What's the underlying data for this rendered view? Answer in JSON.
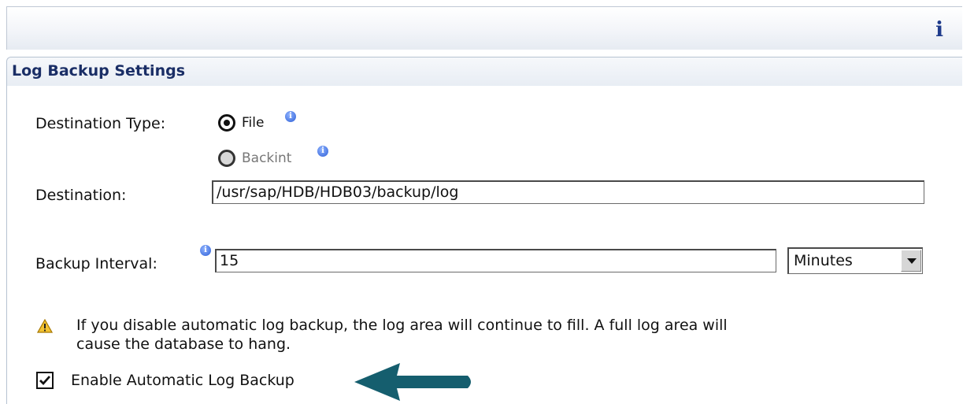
{
  "topbar": {
    "info_icon": "i"
  },
  "panel": {
    "title": "Log Backup Settings"
  },
  "destination_type": {
    "label": "Destination Type:",
    "options": [
      {
        "label": "File",
        "selected": true,
        "enabled": true
      },
      {
        "label": "Backint",
        "selected": false,
        "enabled": false
      }
    ]
  },
  "destination": {
    "label": "Destination:",
    "value": "/usr/sap/HDB/HDB03/backup/log"
  },
  "backup_interval": {
    "label": "Backup Interval:",
    "value": "15",
    "unit": "Minutes"
  },
  "warning": {
    "line1": "If you disable automatic log backup, the log area will continue to fill. A full log area will",
    "line2": "cause the database to hang."
  },
  "enable_auto_backup": {
    "label": "Enable Automatic Log Backup",
    "checked": true
  },
  "colors": {
    "title": "#1a2e66",
    "arrow": "#155e6e",
    "info": "#2e5fd6",
    "warning": "#e0a800"
  },
  "icons": [
    "info-icon",
    "warning-icon",
    "checkbox-checked-icon",
    "arrow-icon"
  ]
}
